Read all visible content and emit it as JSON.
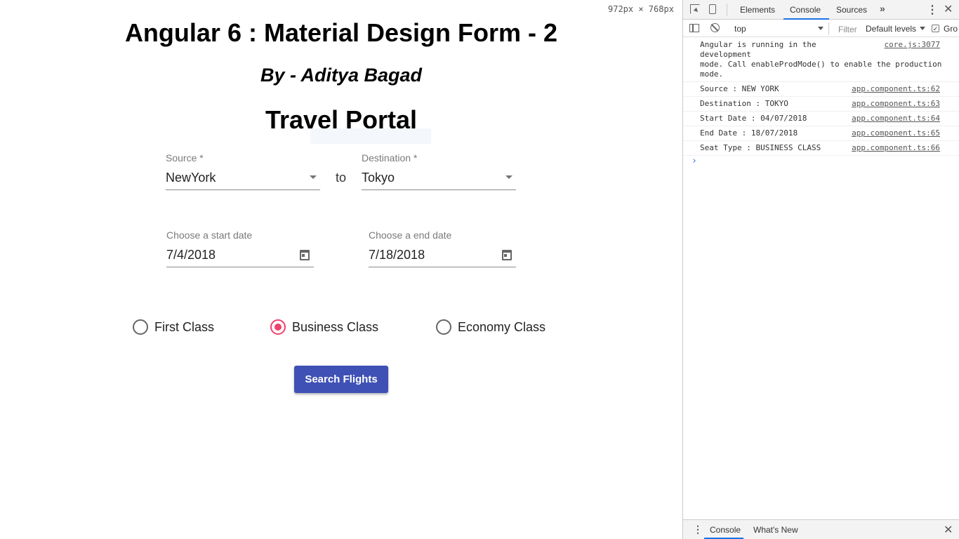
{
  "viewport_indicator": "972px × 768px",
  "app": {
    "title": "Angular 6 : Material Design Form - 2",
    "subtitle": "By - Aditya Bagad",
    "heading": "Travel Portal",
    "source": {
      "label": "Source *",
      "value": "NewYork"
    },
    "connector": "to",
    "destination": {
      "label": "Destination *",
      "value": "Tokyo"
    },
    "start_date": {
      "label": "Choose a start date",
      "value": "7/4/2018"
    },
    "end_date": {
      "label": "Choose a end date",
      "value": "7/18/2018"
    },
    "seat_classes": [
      {
        "label": "First Class",
        "checked": false
      },
      {
        "label": "Business Class",
        "checked": true
      },
      {
        "label": "Economy Class",
        "checked": false
      }
    ],
    "search_button": "Search Flights",
    "accent_color": "#f0426b",
    "primary_color": "#3f51b5"
  },
  "devtools": {
    "tabs": [
      "Elements",
      "Console",
      "Sources"
    ],
    "active_tab": "Console",
    "more": "»",
    "menu": "⋮",
    "close": "✕",
    "context": "top",
    "filter_placeholder": "Filter",
    "levels": "Default levels",
    "group_label": "Gro",
    "checkbox_mark": "✓",
    "logs": [
      {
        "message": "Angular is running in the development mode. Call enableProdMode() to enable the production mode.",
        "line1": "Angular is running in the development",
        "line2": "mode. Call enableProdMode() to enable the production",
        "line3": "mode.",
        "source": "core.js:3077"
      },
      {
        "message": "Source : NEW YORK",
        "source": "app.component.ts:62"
      },
      {
        "message": "Destination : TOKYO",
        "source": "app.component.ts:63"
      },
      {
        "message": "Start Date : 04/07/2018",
        "source": "app.component.ts:64"
      },
      {
        "message": "End Date : 18/07/2018",
        "source": "app.component.ts:65"
      },
      {
        "message": "Seat Type : BUSINESS CLASS",
        "source": "app.component.ts:66"
      }
    ],
    "prompt": "›",
    "drawer": {
      "menu": "⋮",
      "tabs": [
        "Console",
        "What's New"
      ],
      "close": "✕"
    }
  }
}
